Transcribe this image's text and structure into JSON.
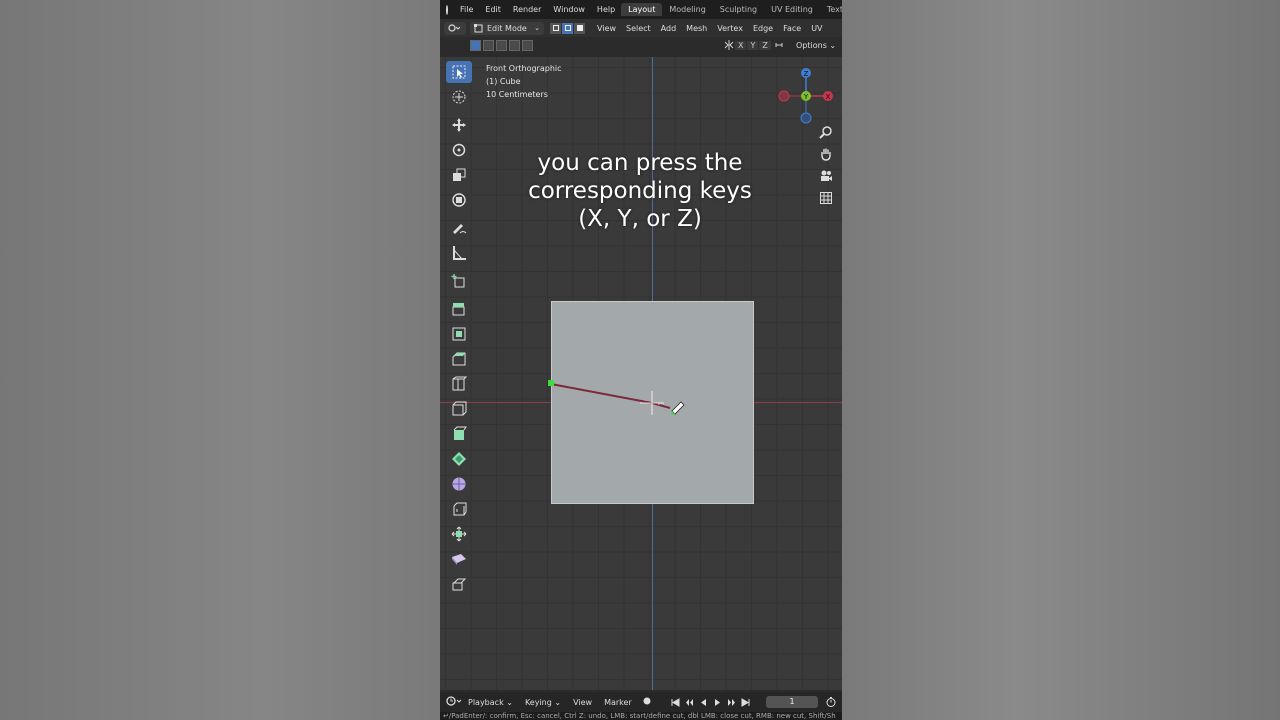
{
  "menubar": {
    "items": [
      "File",
      "Edit",
      "Render",
      "Window",
      "Help"
    ],
    "workspaces": [
      "Layout",
      "Modeling",
      "Sculpting",
      "UV Editing",
      "Texture P"
    ],
    "active_workspace": "Layout"
  },
  "header": {
    "mode": "Edit Mode",
    "menus": [
      "View",
      "Select",
      "Add",
      "Mesh",
      "Vertex",
      "Edge",
      "Face",
      "UV"
    ]
  },
  "subheader": {
    "axes": [
      "X",
      "Y",
      "Z"
    ],
    "options_label": "Options"
  },
  "viewport": {
    "view_name": "Front Orthographic",
    "object_name": "(1) Cube",
    "scale_label": "10 Centimeters",
    "gizmo_labels": {
      "z": "Z",
      "y": "Y",
      "x": "X"
    }
  },
  "caption": {
    "line1": "you can press the",
    "line2": "corresponding keys",
    "line3": "(X, Y, or Z)"
  },
  "timeline": {
    "playback_label": "Playback",
    "keying_label": "Keying",
    "view_label": "View",
    "marker_label": "Marker",
    "current_frame": "1"
  },
  "statusbar": {
    "text": "↵/PadEnter/: confirm, Esc: cancel, Ctrl Z: undo, LMB: start/define cut, dbl LMB: close cut, RMB: new cut, Shift/Sh"
  },
  "colors": {
    "accent": "#4772b3",
    "axis_x": "#c8364d",
    "axis_y": "#7fbf2a",
    "axis_z": "#3f7fd6",
    "cube": "#a3a8aa",
    "knife_line": "#7a2a3a",
    "vertex": "#3ddc3d"
  },
  "icons": {
    "tools": [
      "select-box-icon",
      "cursor-icon",
      "move-icon",
      "rotate-icon",
      "scale-icon",
      "transform-icon",
      "annotate-icon",
      "measure-icon",
      "add-cube-icon",
      "extrude-icon",
      "inset-icon",
      "bevel-icon",
      "loop-cut-icon",
      "offset-edge-icon",
      "knife-icon",
      "poly-build-icon",
      "spin-icon",
      "smooth-icon",
      "edge-slide-icon",
      "shrink-fatten-icon",
      "shear-icon"
    ],
    "nav": [
      "zoom-icon",
      "pan-hand-icon",
      "camera-icon",
      "grid-icon"
    ]
  }
}
